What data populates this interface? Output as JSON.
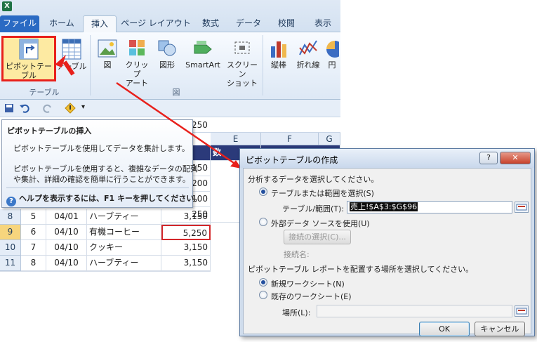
{
  "ribbon": {
    "tabs": [
      "ファイル",
      "ホーム",
      "挿入",
      "ページ レイアウト",
      "数式",
      "データ",
      "校閲",
      "表示"
    ],
    "pivot_button": "ピボットテーブル",
    "table_button": "テーブル",
    "group_table": "テーブル",
    "picture_button": "図",
    "clipart_button_l1": "クリップ",
    "clipart_button_l2": "アート",
    "shapes_button": "図形",
    "smartart_button": "SmartArt",
    "screenshot_l1": "スクリーン",
    "screenshot_l2": "ショット",
    "group_illust": "図",
    "column_chart": "縦棒",
    "line_chart": "折れ線",
    "pie_chart": "円"
  },
  "formula_value": "250",
  "tooltip": {
    "title": "ピボットテーブルの挿入",
    "line1": "ピボットテーブルを使用してデータを集計します。",
    "line2": "ピボットテーブルを使用すると、複雑なデータの配列",
    "line3": "や集計、詳細の確認を簡単に行うことができます。",
    "help": "ヘルプを表示するには、F1 キーを押してください。"
  },
  "sheet": {
    "col_e": "E",
    "col_f": "F",
    "col_g": "G",
    "partial_header": "数",
    "upper_values": [
      "150",
      "200",
      "100",
      "250"
    ],
    "rows": [
      {
        "num": "8",
        "id": "5",
        "date": "04/01",
        "item": "ハーブティー",
        "amount": "3,150"
      },
      {
        "num": "9",
        "id": "6",
        "date": "04/10",
        "item": "有機コーヒー",
        "amount": "5,250"
      },
      {
        "num": "10",
        "id": "7",
        "date": "04/10",
        "item": "クッキー",
        "amount": "3,150"
      },
      {
        "num": "11",
        "id": "8",
        "date": "04/10",
        "item": "ハーブティー",
        "amount": "3,150"
      }
    ]
  },
  "dialog": {
    "title": "ピボットテーブルの作成",
    "help_btn": "?",
    "close_btn": "✕",
    "section1": "分析するデータを選択してください。",
    "opt_table": "テーブルまたは範囲を選択(S)",
    "range_label": "テーブル/範囲(T):",
    "range_value": "売上!$A$3:$G$96",
    "opt_external": "外部データ ソースを使用(U)",
    "choose_conn": "接続の選択(C)...",
    "conn_name_label": "接続名:",
    "section2": "ピボットテーブル レポートを配置する場所を選択してください。",
    "opt_new_sheet": "新規ワークシート(N)",
    "opt_existing_sheet": "既存のワークシート(E)",
    "location_label": "場所(L):",
    "ok": "OK",
    "cancel": "キャンセル"
  },
  "colors": {
    "accent_red": "#e8201b",
    "ribbon_blue": "#2a6ac3",
    "header_dark": "#2b3a7a"
  }
}
